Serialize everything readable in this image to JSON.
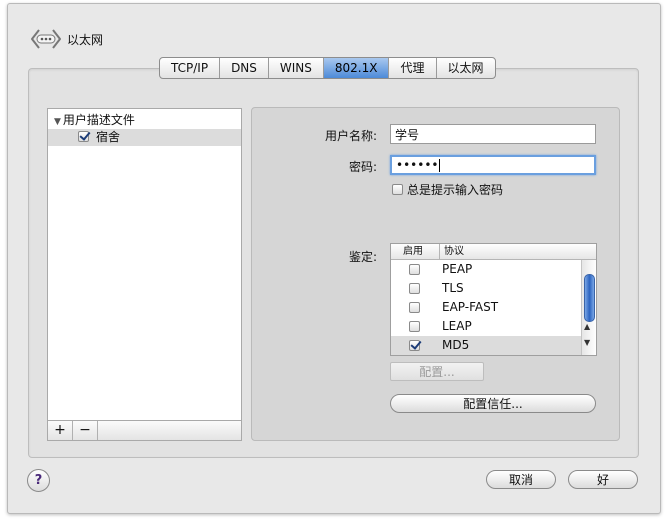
{
  "window": {
    "title": "以太网",
    "icon": "network-icon"
  },
  "tabs": [
    {
      "label": "TCP/IP",
      "active": false
    },
    {
      "label": "DNS",
      "active": false
    },
    {
      "label": "WINS",
      "active": false
    },
    {
      "label": "802.1X",
      "active": true
    },
    {
      "label": "代理",
      "active": false
    },
    {
      "label": "以太网",
      "active": false
    }
  ],
  "profiles": {
    "root_label": "用户描述文件",
    "item_label": "宿舍",
    "item_checked": true,
    "add_label": "+",
    "remove_label": "−"
  },
  "settings": {
    "username_label": "用户名称:",
    "username_value": "学号",
    "password_label": "密码:",
    "password_value": "••••••",
    "always_prompt_label": "总是提示输入密码",
    "always_prompt_checked": false,
    "auth_label": "鉴定:",
    "auth_columns": [
      "启用",
      "协议"
    ],
    "auth_protocols": [
      {
        "name": "PEAP",
        "enabled": false,
        "selected": false
      },
      {
        "name": "TLS",
        "enabled": false,
        "selected": false
      },
      {
        "name": "EAP-FAST",
        "enabled": false,
        "selected": false
      },
      {
        "name": "LEAP",
        "enabled": false,
        "selected": false
      },
      {
        "name": "MD5",
        "enabled": true,
        "selected": true
      }
    ],
    "configure_label": "配置...",
    "configure_trust_label": "配置信任..."
  },
  "footer": {
    "help": "?",
    "cancel": "取消",
    "ok": "好"
  },
  "colors": {
    "active_tab": "#4d8ad8",
    "focus_ring": "#6a9fdf",
    "scroll_thumb": "#2b63c0"
  }
}
